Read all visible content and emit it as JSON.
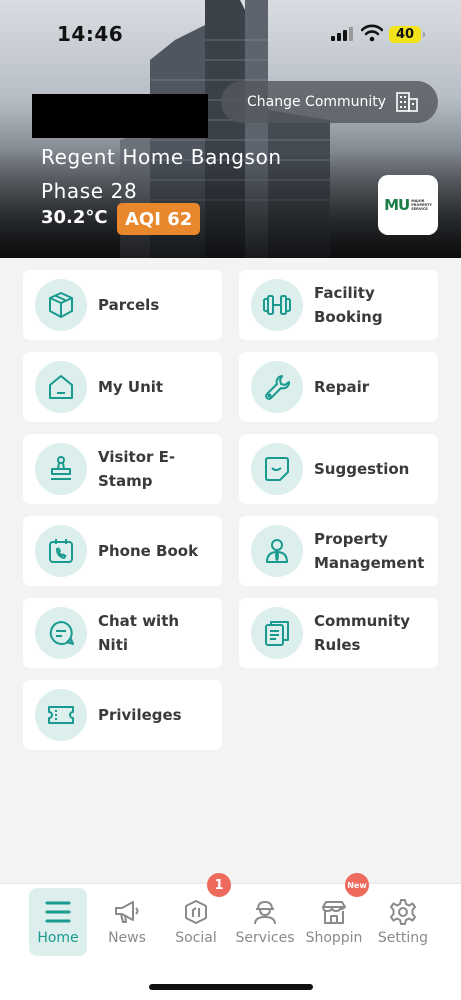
{
  "status": {
    "time": "14:46",
    "battery": "40"
  },
  "header": {
    "change_community": "Change Community",
    "community_line1": "Regent Home Bangson",
    "community_line2": "Phase 28",
    "temperature": "30.2°C",
    "aqi": "AQI 62",
    "logo_text": "MU",
    "logo_caption1": "MAJOR",
    "logo_caption2": "PROPERTY",
    "logo_caption3": "SERVICE"
  },
  "menu": [
    {
      "label": "Parcels",
      "icon": "box-icon"
    },
    {
      "label": "Facility Booking",
      "icon": "dumbbell-icon"
    },
    {
      "label": "My Unit",
      "icon": "house-icon"
    },
    {
      "label": "Repair",
      "icon": "wrench-icon"
    },
    {
      "label": "Visitor E-Stamp",
      "icon": "stamp-icon"
    },
    {
      "label": "Suggestion",
      "icon": "note-icon"
    },
    {
      "label": "Phone Book",
      "icon": "phone-calendar-icon"
    },
    {
      "label": "Property Management",
      "icon": "person-icon"
    },
    {
      "label": "Chat with Niti",
      "icon": "chat-icon"
    },
    {
      "label": "Community Rules",
      "icon": "rules-icon"
    },
    {
      "label": "Privileges",
      "icon": "ticket-icon"
    }
  ],
  "nav": {
    "home": "Home",
    "news": "News",
    "social": "Social",
    "social_badge": "1",
    "services": "Services",
    "shopping": "Shoppin",
    "shopping_badge": "New",
    "setting": "Setting"
  },
  "colors": {
    "accent": "#1a9a8e",
    "icon_bg": "#dcefed",
    "aqi": "#e8872c",
    "badge": "#ee6a5c"
  }
}
